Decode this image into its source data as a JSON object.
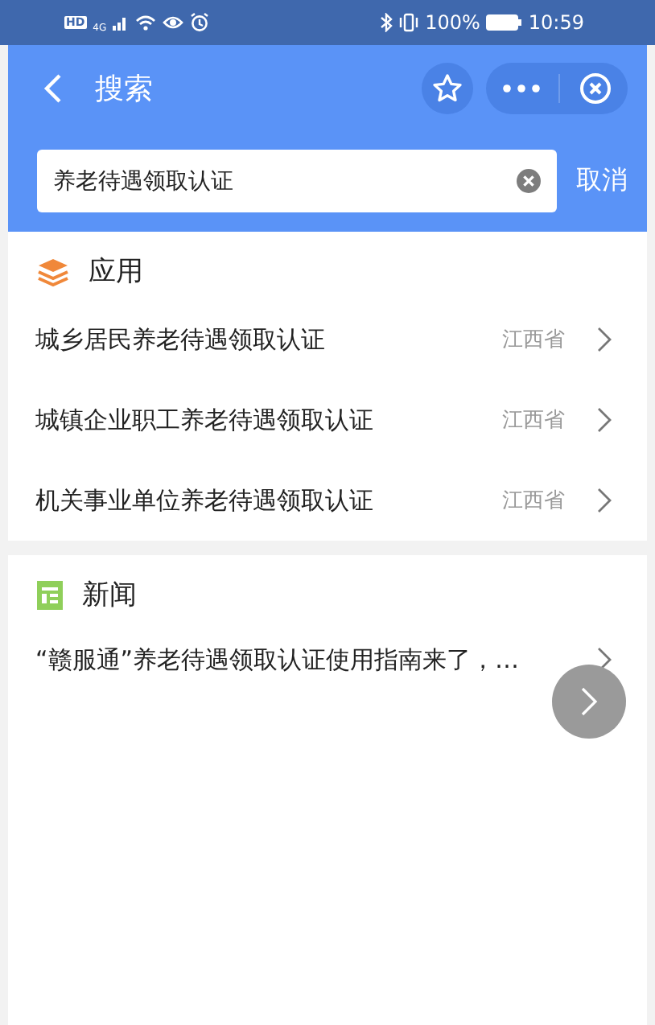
{
  "status_bar": {
    "hd": "HD",
    "network": "4G",
    "battery": "100%",
    "time": "10:59"
  },
  "nav": {
    "title": "搜索"
  },
  "search": {
    "value": "养老待遇领取认证",
    "cancel": "取消"
  },
  "apps": {
    "title": "应用",
    "items": [
      {
        "name": "城乡居民养老待遇领取认证",
        "region": "江西省"
      },
      {
        "name": "城镇企业职工养老待遇领取认证",
        "region": "江西省"
      },
      {
        "name": "机关事业单位养老待遇领取认证",
        "region": "江西省"
      }
    ]
  },
  "news": {
    "title": "新闻",
    "items": [
      {
        "title": "“赣服通”养老待遇领取认证使用指南来了，…"
      }
    ]
  }
}
